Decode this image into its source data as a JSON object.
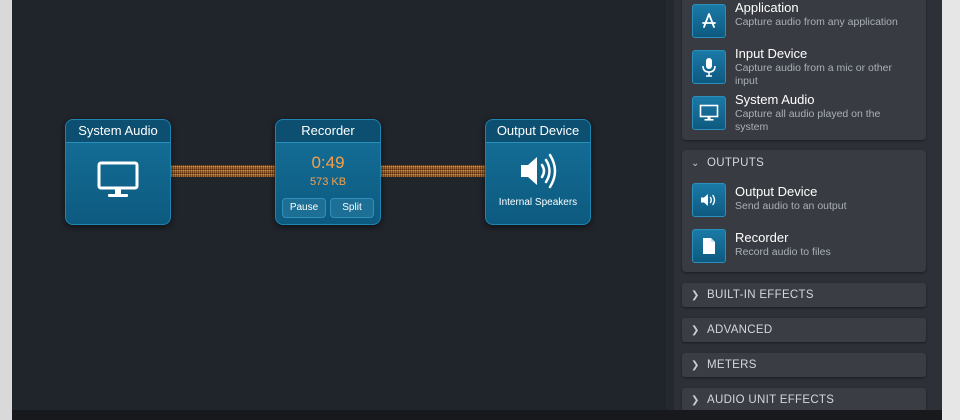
{
  "nodes": {
    "system_audio": {
      "title": "System Audio",
      "icon": "monitor-icon"
    },
    "recorder": {
      "title": "Recorder",
      "time": "0:49",
      "size": "573 KB",
      "pause_label": "Pause",
      "split_label": "Split"
    },
    "output_device": {
      "title": "Output Device",
      "icon": "speaker-icon",
      "device": "Internal Speakers"
    }
  },
  "sidebar": {
    "sources": [
      {
        "title": "Application",
        "desc": "Capture audio from any application",
        "icon": "app-store-icon"
      },
      {
        "title": "Input Device",
        "desc": "Capture audio from a mic or other input",
        "icon": "microphone-icon"
      },
      {
        "title": "System Audio",
        "desc": "Capture all audio played on the system",
        "icon": "monitor-icon"
      }
    ],
    "outputs_header": "OUTPUTS",
    "outputs": [
      {
        "title": "Output Device",
        "desc": "Send audio to an output",
        "icon": "speaker-icon"
      },
      {
        "title": "Recorder",
        "desc": "Record audio to files",
        "icon": "file-icon"
      }
    ],
    "collapsed_sections": [
      "BUILT-IN EFFECTS",
      "ADVANCED",
      "METERS",
      "AUDIO UNIT EFFECTS"
    ]
  },
  "colors": {
    "accent_orange": "#f5a04a",
    "node_blue": "#15719a",
    "cable_orange": "#e8963a"
  }
}
